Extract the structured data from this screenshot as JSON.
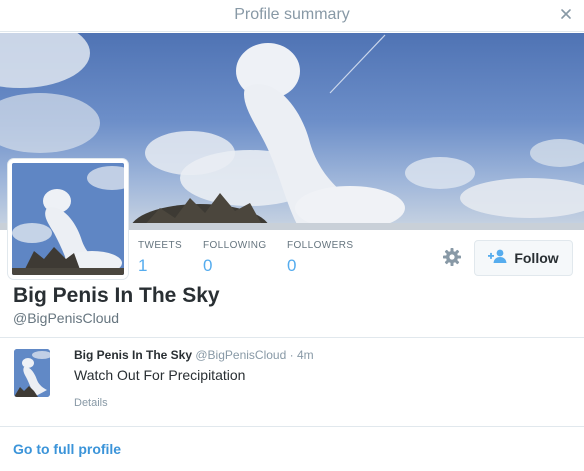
{
  "modal": {
    "title": "Profile summary",
    "close_icon": "close-icon"
  },
  "profile": {
    "name": "Big Penis In The Sky",
    "handle": "@BigPenisCloud",
    "stats": [
      {
        "label": "TWEETS",
        "value": "1"
      },
      {
        "label": "FOLLOWING",
        "value": "0"
      },
      {
        "label": "FOLLOWERS",
        "value": "0"
      }
    ],
    "settings_icon": "gear-icon",
    "follow_label": "Follow",
    "follow_icon": "add-user-icon"
  },
  "tweet": {
    "name": "Big Penis In The Sky",
    "handle": "@BigPenisCloud",
    "time": "· 4m",
    "text": "Watch Out For Precipitation",
    "details_label": "Details"
  },
  "footer": {
    "link_label": "Go to full profile"
  },
  "colors": {
    "accent": "#55acee",
    "link": "#3b94d9",
    "muted": "#8899a6",
    "border": "#e1e8ed"
  }
}
